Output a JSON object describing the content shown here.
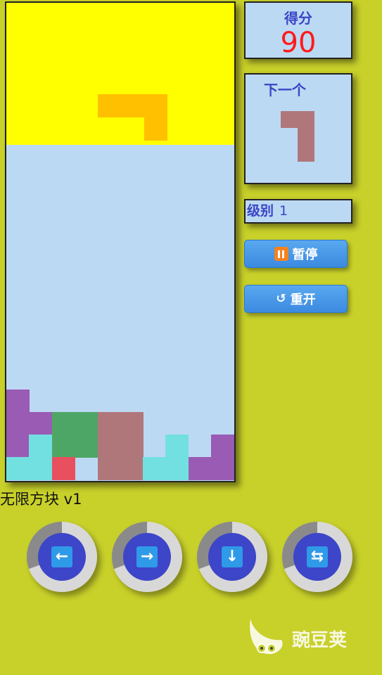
{
  "score": {
    "title": "得分",
    "value": "90"
  },
  "next": {
    "title": "下一个",
    "color": "#b0777b"
  },
  "level": {
    "label": "级别",
    "value": "1"
  },
  "buttons": {
    "pause": "暂停",
    "restart": "重开",
    "restart_icon": "↺"
  },
  "app_title": "无限方块 v1",
  "controls": [
    {
      "name": "left-arrow-icon",
      "glyph": "←"
    },
    {
      "name": "right-arrow-icon",
      "glyph": "→"
    },
    {
      "name": "down-arrow-icon",
      "glyph": "↓"
    },
    {
      "name": "rotate-icon",
      "glyph": "⇆"
    }
  ],
  "watermark": "豌豆荚",
  "colors": {
    "background": "#c8d02a",
    "board": "#bcd9f3",
    "spawn_zone": "#ffff00",
    "falling_piece": "#ffc000",
    "purple": "#9a5bb4",
    "cyan": "#72e0e0",
    "green": "#4ea666",
    "mauve": "#b0777b",
    "red": "#e8505e"
  }
}
